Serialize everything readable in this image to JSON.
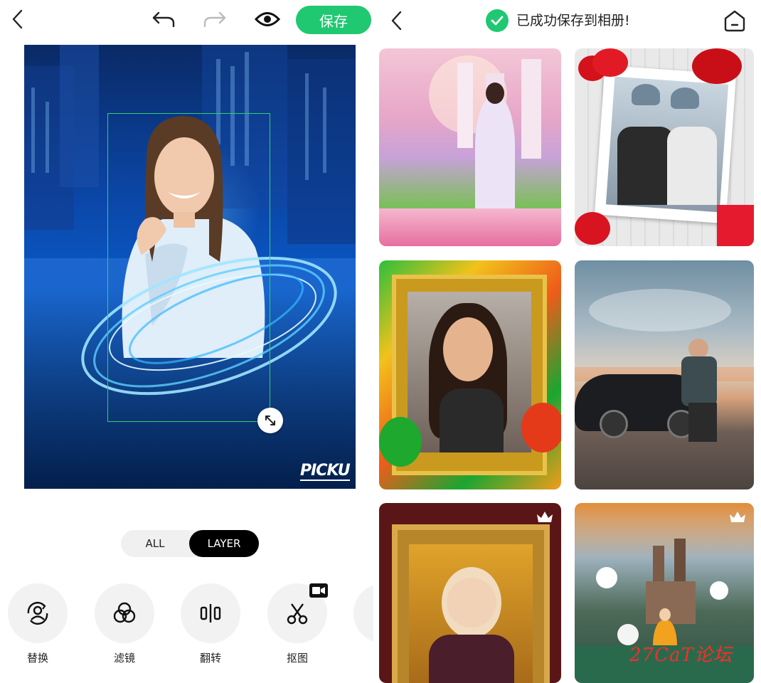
{
  "editor": {
    "back_icon": "chevron-left-icon",
    "undo_icon": "undo-icon",
    "redo_icon": "redo-icon",
    "preview_icon": "eye-icon",
    "save_label": "保存",
    "canvas_logo": "PICKU",
    "resize_handle_icon": "resize-diagonal-icon",
    "toggle": {
      "all_label": "ALL",
      "layer_label": "LAYER",
      "selected": "LAYER"
    },
    "tools": [
      {
        "label": "替换",
        "icon": "replace-person-icon"
      },
      {
        "label": "滤镜",
        "icon": "filter-circles-icon"
      },
      {
        "label": "翻转",
        "icon": "flip-icon"
      },
      {
        "label": "抠图",
        "icon": "scissors-icon",
        "badge_icon": "video-badge-icon"
      }
    ]
  },
  "gallery": {
    "back_icon": "chevron-left-icon",
    "success_icon": "check-circle-icon",
    "success_message": "已成功保存到相册!",
    "home_icon": "home-icon",
    "premium_icon": "crown-icon",
    "watermark": "27CaT论坛"
  },
  "colors": {
    "accent_green": "#20c872",
    "toggle_selected_bg": "#000000",
    "watermark_red": "#ff2a2a"
  }
}
